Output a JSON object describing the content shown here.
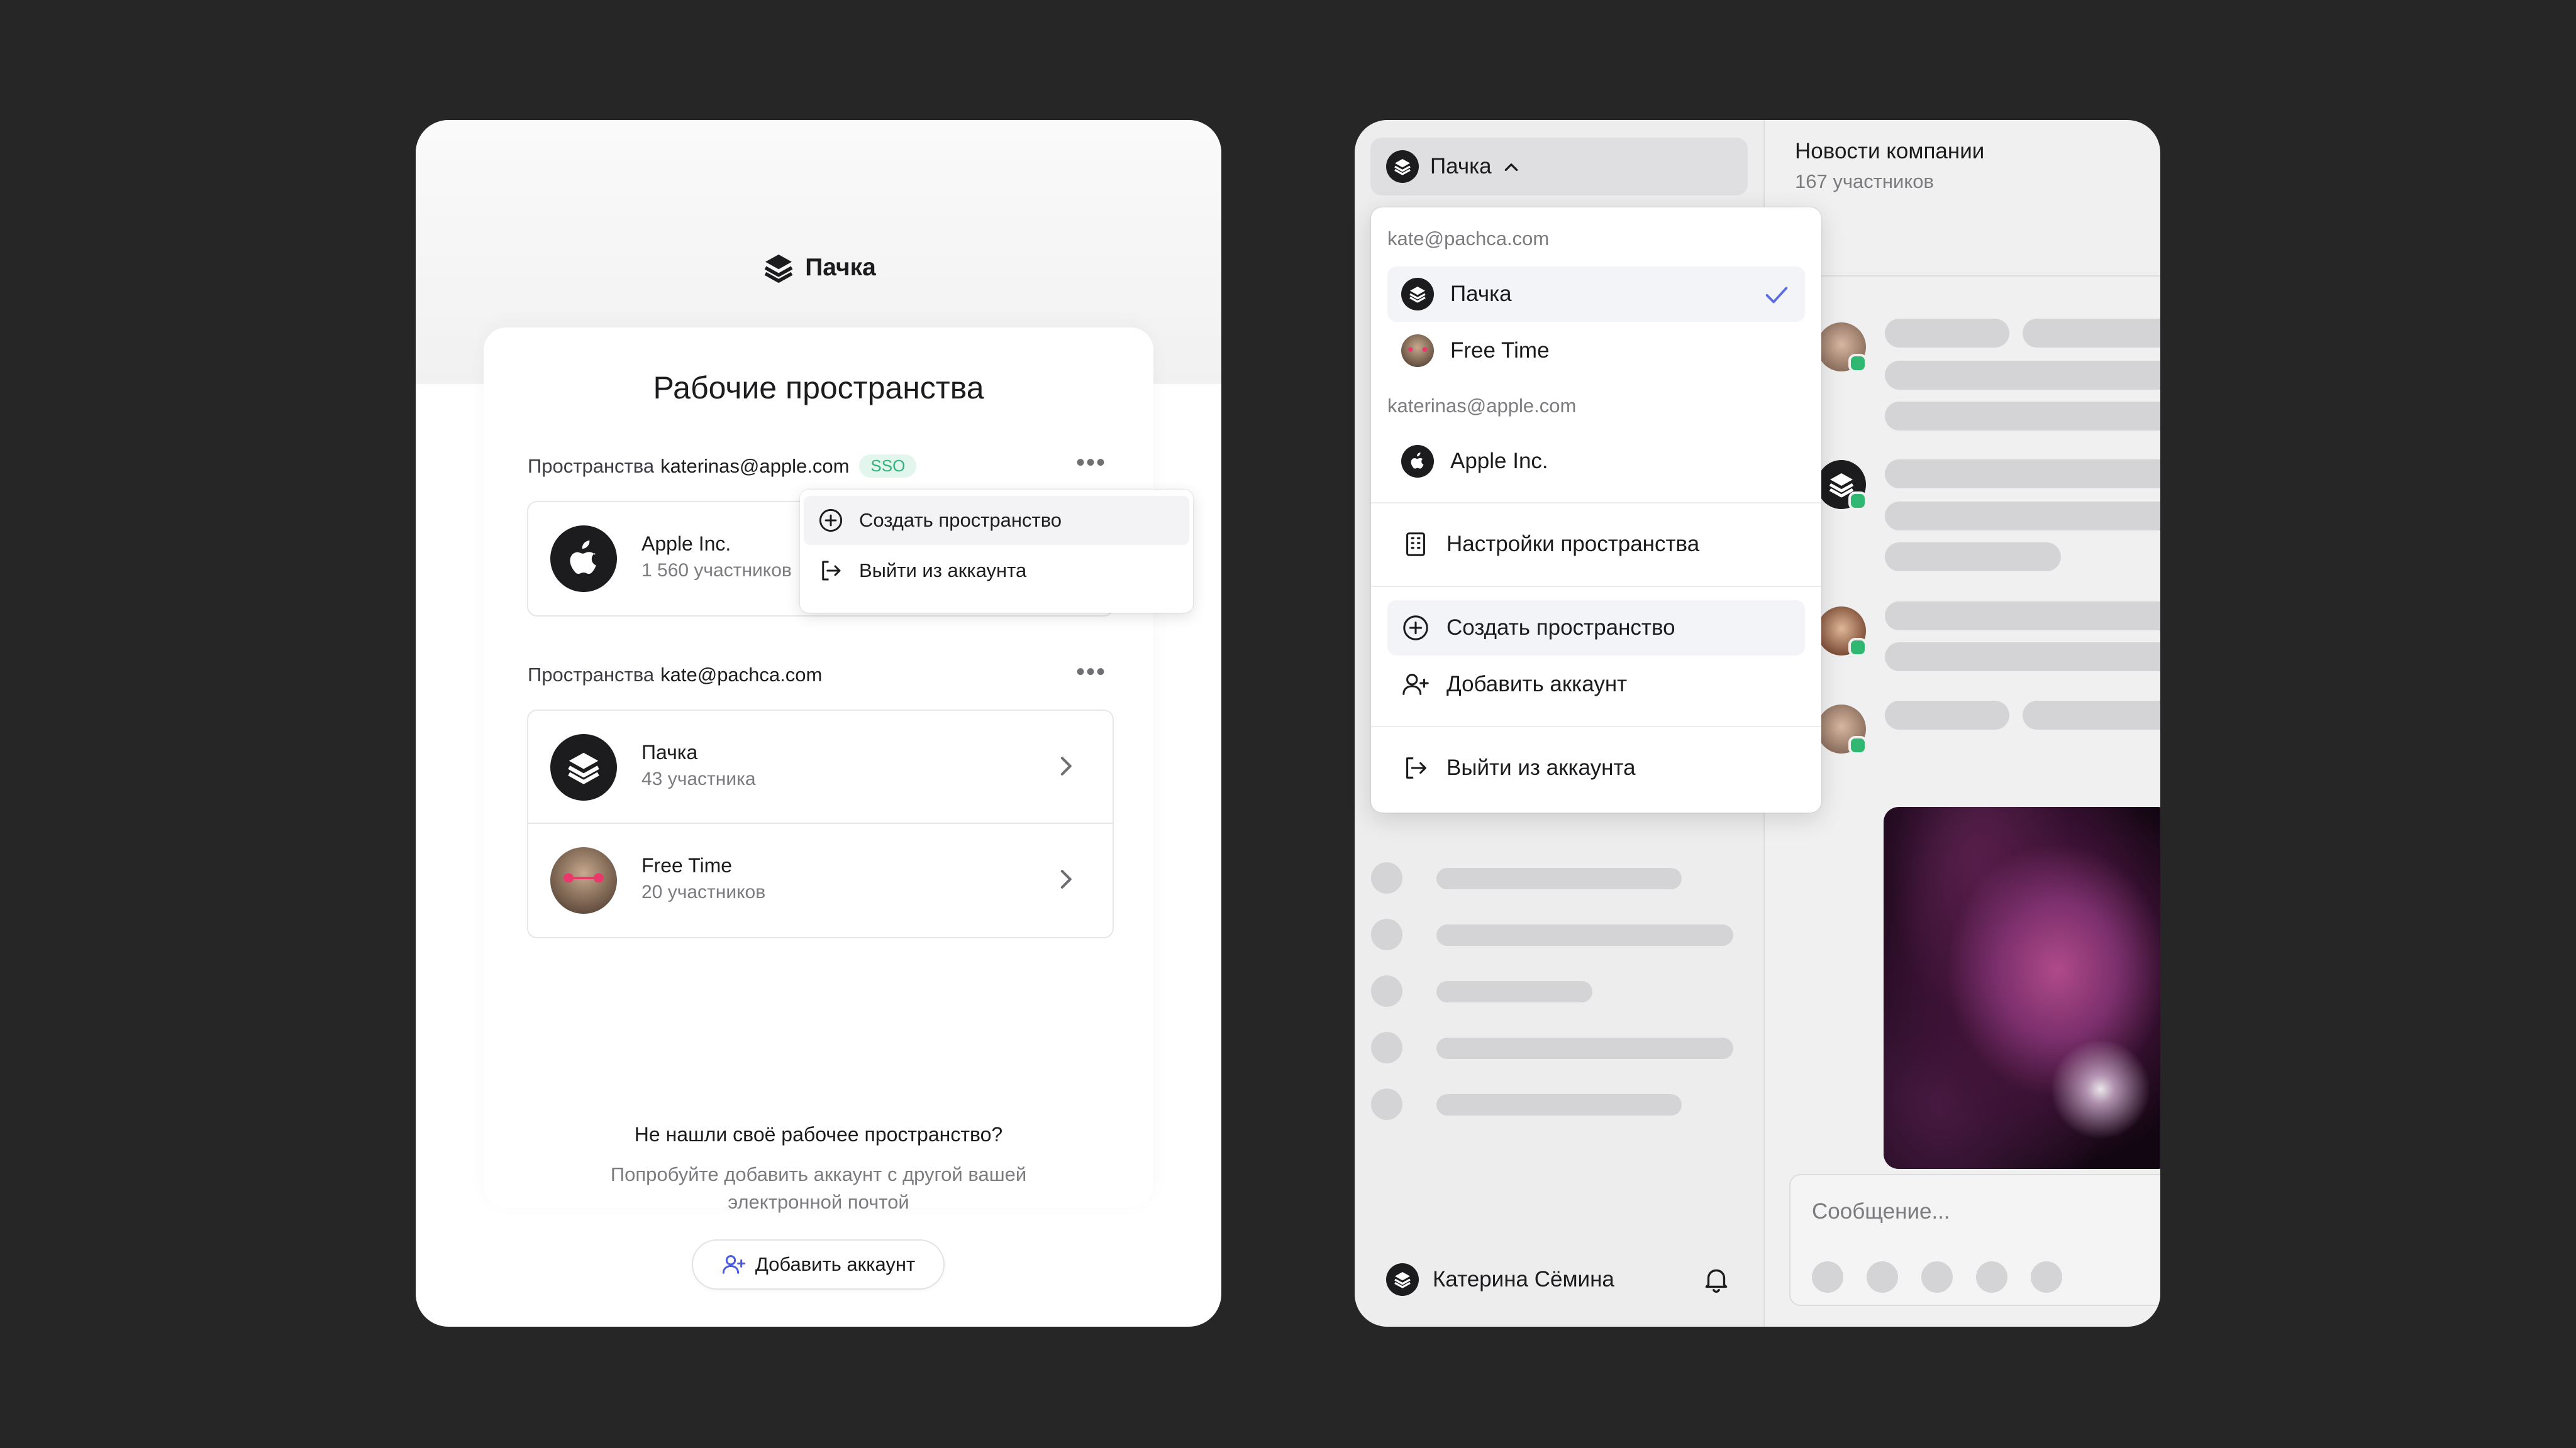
{
  "left": {
    "brand": "Пачка",
    "title": "Рабочие пространства",
    "sections": [
      {
        "prefix": "Пространства",
        "email": "katerinas@apple.com",
        "badge": "SSO",
        "more": "•••",
        "workspaces": [
          {
            "name": "Apple Inc.",
            "members": "1 560 участников"
          }
        ]
      },
      {
        "prefix": "Пространства",
        "email": "kate@pachca.com",
        "more": "•••",
        "workspaces": [
          {
            "name": "Пачка",
            "members": "43 участника"
          },
          {
            "name": "Free Time",
            "members": "20 участников"
          }
        ]
      }
    ],
    "context_menu": {
      "create": "Создать пространство",
      "logout": "Выйти из аккаунта"
    },
    "not_found": {
      "title": "Не нашли своё рабочее пространство?",
      "text": "Попробуйте добавить аккаунт с другой вашей электронной почтой",
      "button": "Добавить аккаунт"
    }
  },
  "right": {
    "switcher": {
      "label": "Пачка",
      "caret": "^"
    },
    "channel": {
      "title": "Новости компании",
      "members": "167 участников"
    },
    "user": {
      "name": "Катерина Сёмина"
    },
    "composer": {
      "placeholder": "Сообщение..."
    },
    "dropdown": {
      "accounts": [
        {
          "email": "kate@pachca.com",
          "items": [
            {
              "name": "Пачка",
              "selected": true
            },
            {
              "name": "Free Time",
              "selected": false
            }
          ]
        },
        {
          "email": "katerinas@apple.com",
          "items": [
            {
              "name": "Apple Inc.",
              "selected": false
            }
          ]
        }
      ],
      "settings": "Настройки пространства",
      "create": "Создать пространство",
      "add_account": "Добавить аккаунт",
      "logout": "Выйти из аккаунта"
    }
  },
  "colors": {
    "background": "#262626",
    "accent_check": "#5b6de0",
    "sso_text": "#33b27c",
    "online": "#30b873"
  }
}
